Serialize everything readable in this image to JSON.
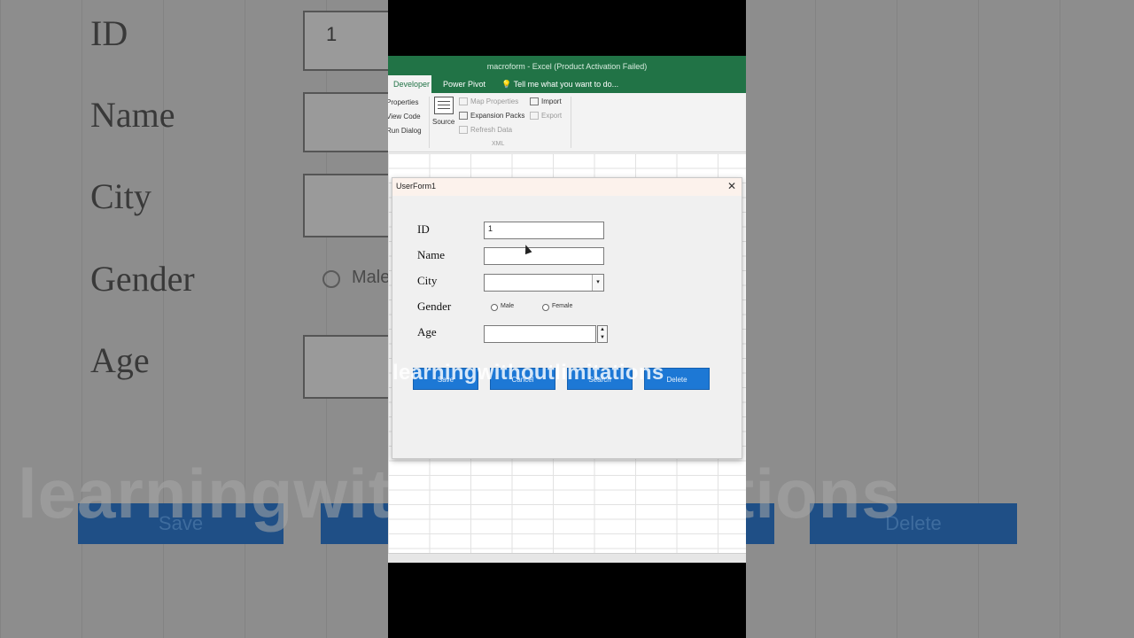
{
  "window": {
    "title": "macroform - Excel (Product Activation Failed)"
  },
  "ribbon": {
    "tabs": [
      "Developer",
      "Power Pivot"
    ],
    "tell_me": "Tell me what you want to do...",
    "controls_group": [
      "Properties",
      "View Code",
      "Run Dialog"
    ],
    "source_label": "Source",
    "xml_items": {
      "map_properties": "Map Properties",
      "expansion_packs": "Expansion Packs",
      "refresh_data": "Refresh Data",
      "import": "Import",
      "export": "Export"
    },
    "xml_group_label": "XML"
  },
  "form": {
    "title": "UserForm1",
    "close_glyph": "✕",
    "labels": {
      "id": "ID",
      "name": "Name",
      "city": "City",
      "gender": "Gender",
      "age": "Age"
    },
    "values": {
      "id": "1",
      "name": "",
      "city": "",
      "age": ""
    },
    "gender_options": [
      "Male",
      "Female"
    ],
    "buttons": {
      "save": "Save",
      "cancel": "Cancel",
      "search": "Search",
      "delete": "Delete"
    },
    "combo_arrow": "▾",
    "spin_up": "▲",
    "spin_down": "▼"
  },
  "watermark": "learningwithoutlimitations",
  "background": {
    "labels": {
      "id": "ID",
      "name": "Name",
      "city": "City",
      "gender": "Gender",
      "age": "Age"
    },
    "id_value": "1",
    "gender_option": "Male",
    "buttons": {
      "save": "Save",
      "delete": "Delete"
    },
    "watermark": "learningwithoutlimitations"
  },
  "colors": {
    "excel_green": "#217346",
    "button_blue": "#1d78d5"
  }
}
